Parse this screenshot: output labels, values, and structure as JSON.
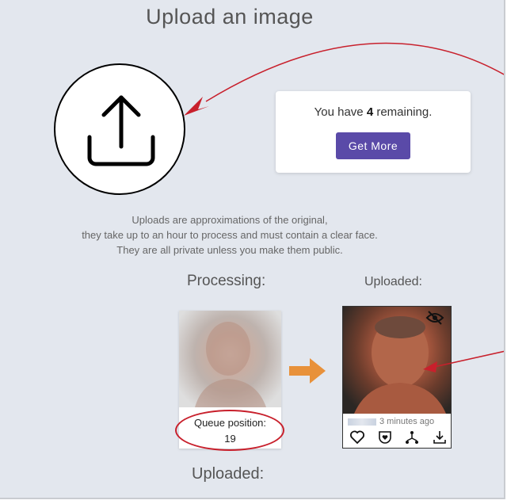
{
  "page": {
    "title": "Upload an image",
    "remaining_prefix": "You have ",
    "remaining_count": "4",
    "remaining_suffix": " remaining.",
    "get_more_label": "Get More",
    "info_line1": "Uploads are approximations of the original,",
    "info_line2": "they take up to an hour to process and must contain a clear face.",
    "info_line3": "They are all private unless you make them public."
  },
  "processing": {
    "label": "Processing:",
    "queue_label": "Queue position:",
    "queue_position": "19"
  },
  "uploaded": {
    "label_top": "Uploaded:",
    "label_bottom": "Uploaded:",
    "time_ago": "3 minutes ago",
    "icons": [
      "heart-icon",
      "badge-heart-icon",
      "share-network-icon",
      "download-icon"
    ]
  },
  "colors": {
    "background": "#e3e7ee",
    "accent": "#5a4aa8",
    "annotation_red": "#c8202c",
    "arrow_orange": "#e8913a"
  }
}
